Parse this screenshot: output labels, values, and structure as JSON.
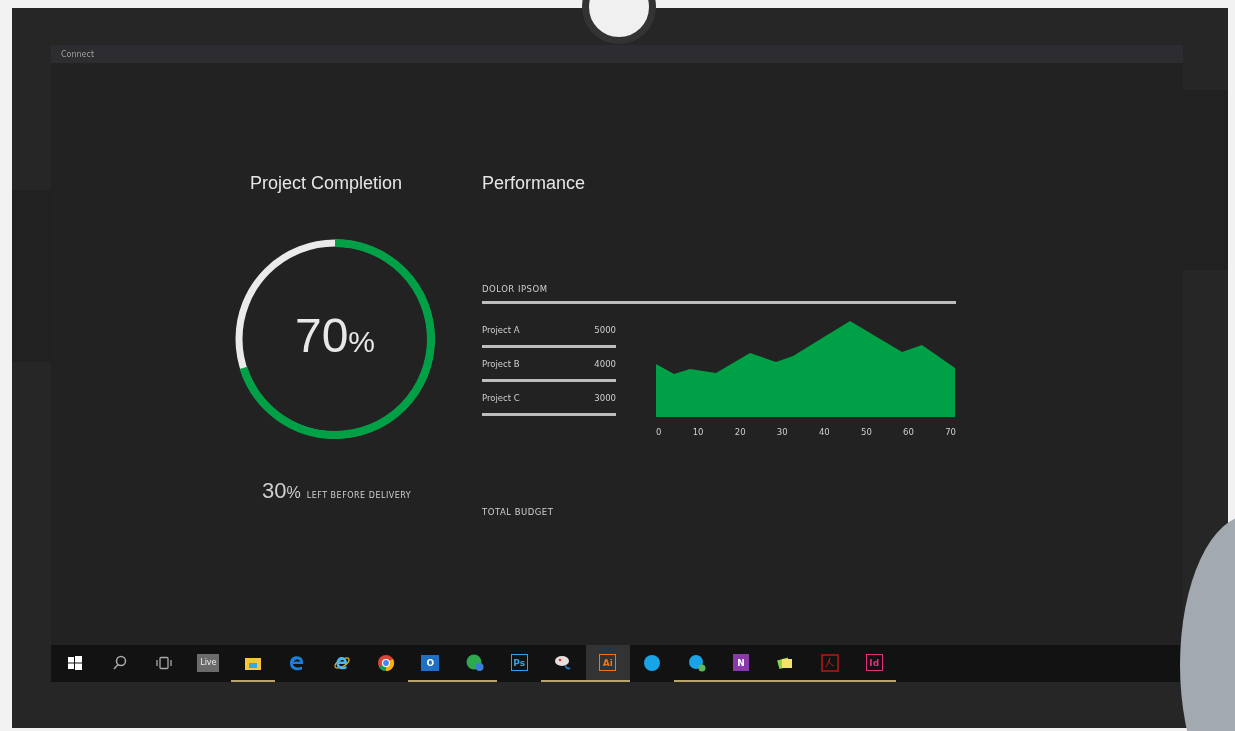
{
  "window": {
    "title": "Connect"
  },
  "completion": {
    "title": "Project Completion",
    "value": "70",
    "unit": "%",
    "level": 0.7,
    "remaining_value": "30",
    "remaining_unit": "%",
    "remaining_label": "LEFT BEFORE DELIVERY"
  },
  "performance": {
    "title": "Performance",
    "section_label": "DOLOR IPSOM",
    "projects": [
      {
        "name": "Project A",
        "value": "5000"
      },
      {
        "name": "Project B",
        "value": "4000"
      },
      {
        "name": "Project C",
        "value": "3000"
      }
    ],
    "x_axis_labels": [
      "0",
      "10",
      "20",
      "30",
      "40",
      "50",
      "60",
      "70"
    ],
    "footer_label": "TOTAL BUDGET"
  },
  "taskbar": [
    {
      "kind": "start",
      "open": false,
      "selected": false
    },
    {
      "kind": "search",
      "open": false,
      "selected": false
    },
    {
      "kind": "taskview",
      "open": false,
      "selected": false
    },
    {
      "kind": "tile",
      "text": "Live",
      "open": false,
      "selected": false
    },
    {
      "kind": "folder",
      "open": true,
      "selected": false
    },
    {
      "kind": "edge",
      "open": false,
      "selected": false
    },
    {
      "kind": "ie",
      "open": false,
      "selected": false
    },
    {
      "kind": "chrome",
      "open": false,
      "selected": false
    },
    {
      "kind": "mail",
      "text": "O",
      "open": true,
      "selected": false
    },
    {
      "kind": "music",
      "open": true,
      "selected": false
    },
    {
      "kind": "square",
      "text": "Ps",
      "color": "#2fa3e6",
      "open": false,
      "selected": false
    },
    {
      "kind": "paint",
      "open": true,
      "selected": false
    },
    {
      "kind": "square",
      "text": "Ai",
      "color": "#e8781e",
      "open": true,
      "selected": true
    },
    {
      "kind": "chat",
      "open": false,
      "selected": false
    },
    {
      "kind": "chat2",
      "open": true,
      "selected": false
    },
    {
      "kind": "note",
      "text": "N",
      "open": true,
      "selected": false
    },
    {
      "kind": "sticky",
      "open": true,
      "selected": false
    },
    {
      "kind": "pdf",
      "open": true,
      "selected": false
    },
    {
      "kind": "square",
      "text": "Id",
      "color": "#e0317a",
      "open": true,
      "selected": false
    }
  ]
}
